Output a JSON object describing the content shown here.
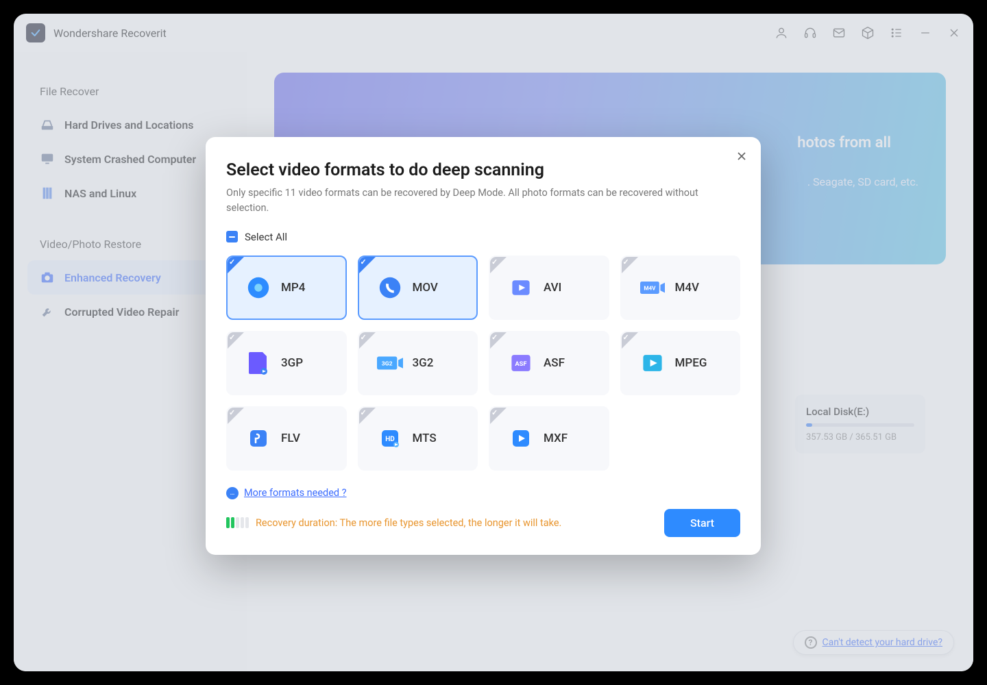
{
  "app": {
    "title": "Wondershare Recoverit"
  },
  "titlebar_icons": [
    "user-icon",
    "headset-icon",
    "mail-icon",
    "cube-icon",
    "list-icon",
    "minimize-icon",
    "close-icon"
  ],
  "sidebar": {
    "section1": {
      "label": "File Recover",
      "items": [
        {
          "icon": "drive-icon",
          "label": "Hard Drives and Locations"
        },
        {
          "icon": "monitor-icon",
          "label": "System Crashed Computer"
        },
        {
          "icon": "server-icon",
          "label": "NAS and Linux"
        }
      ]
    },
    "section2": {
      "label": "Video/Photo Restore",
      "items": [
        {
          "icon": "camera-icon",
          "label": "Enhanced Recovery",
          "active": true
        },
        {
          "icon": "wrench-icon",
          "label": "Corrupted Video Repair"
        }
      ]
    }
  },
  "banner": {
    "title_fragment": "hotos from all",
    "subtitle_fragment": ". Seagate, SD card, etc."
  },
  "disk": {
    "name": "Local Disk(E:)",
    "size": "357.53 GB / 365.51 GB"
  },
  "footer": {
    "link": "Can't detect your hard drive?"
  },
  "modal": {
    "title": "Select video formats to do deep scanning",
    "subtitle": "Only specific 11 video formats can be recovered by Deep Mode. All photo formats can be recovered without selection.",
    "select_all": "Select All",
    "formats": [
      {
        "label": "MP4",
        "selected": true,
        "icon": "mp4"
      },
      {
        "label": "MOV",
        "selected": true,
        "icon": "mov"
      },
      {
        "label": "AVI",
        "selected": false,
        "icon": "avi"
      },
      {
        "label": "M4V",
        "selected": false,
        "icon": "m4v"
      },
      {
        "label": "3GP",
        "selected": false,
        "icon": "3gp"
      },
      {
        "label": "3G2",
        "selected": false,
        "icon": "3g2"
      },
      {
        "label": "ASF",
        "selected": false,
        "icon": "asf"
      },
      {
        "label": "MPEG",
        "selected": false,
        "icon": "mpeg"
      },
      {
        "label": "FLV",
        "selected": false,
        "icon": "flv"
      },
      {
        "label": "MTS",
        "selected": false,
        "icon": "mts"
      },
      {
        "label": "MXF",
        "selected": false,
        "icon": "mxf"
      }
    ],
    "more_link": "More formats needed ?",
    "warning": "Recovery duration: The more file types selected, the longer it will take.",
    "start": "Start"
  }
}
